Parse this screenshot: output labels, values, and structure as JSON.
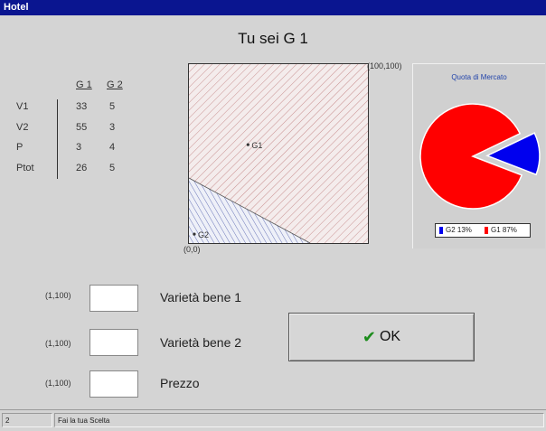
{
  "window": {
    "title": "Hotel"
  },
  "heading": "Tu sei G 1",
  "table": {
    "columns": [
      "G 1",
      "G 2"
    ],
    "rows": [
      {
        "label": "V1",
        "g1": "33",
        "g2": "5"
      },
      {
        "label": "V2",
        "g1": "55",
        "g2": "3"
      },
      {
        "label": "P",
        "g1": "3",
        "g2": "4"
      },
      {
        "label": "Ptot",
        "g1": "26",
        "g2": "5"
      }
    ]
  },
  "plot": {
    "corner_max": "(100,100)",
    "corner_min": "(0,0)",
    "points": [
      {
        "label": "G1",
        "x": 33,
        "y": 55
      },
      {
        "label": "G2",
        "x": 3,
        "y": 5
      }
    ]
  },
  "market_share": {
    "title": "Quota di Mercato",
    "chart_data": {
      "type": "pie",
      "categories": [
        "G2",
        "G1"
      ],
      "values": [
        13,
        87
      ],
      "colors": [
        "#0000ee",
        "#ff0000"
      ]
    },
    "legend": [
      "G2 13%",
      "G1 87%"
    ]
  },
  "inputs": [
    {
      "range": "(1,100)",
      "label": "Varietà bene 1",
      "value": ""
    },
    {
      "range": "(1,100)",
      "label": "Varietà bene 2",
      "value": ""
    },
    {
      "range": "(1,100)",
      "label": "Prezzo",
      "value": ""
    }
  ],
  "ok_button": {
    "label": "OK",
    "icon": "checkmark-icon"
  },
  "status": {
    "left": "2",
    "message": "Fai la tua Scelta"
  }
}
